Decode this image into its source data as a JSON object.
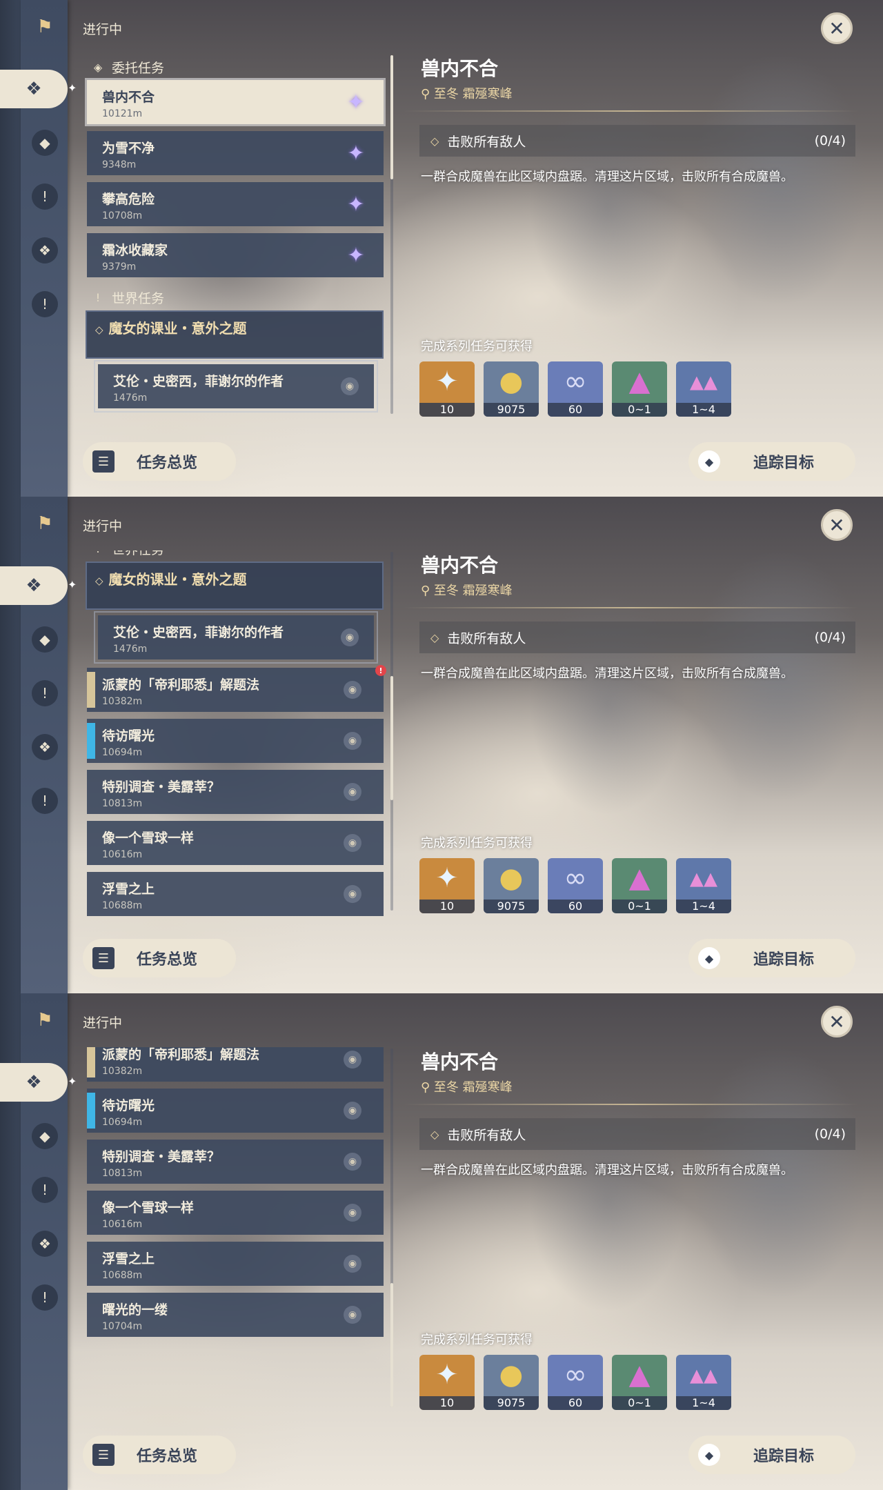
{
  "header": {
    "status_label": "进行中"
  },
  "categories": {
    "commission": "委托任务",
    "world": "世界任务"
  },
  "commission_quests": [
    {
      "name": "兽内不合",
      "distance": "10121m"
    },
    {
      "name": "为雪不净",
      "distance": "9348m"
    },
    {
      "name": "攀高危险",
      "distance": "10708m"
    },
    {
      "name": "霜冰收藏家",
      "distance": "9379m"
    }
  ],
  "world_chapter": {
    "title": "魔女的课业・意外之题"
  },
  "world_sub": {
    "name": "艾伦・史密西，菲谢尔的作者",
    "distance": "1476m"
  },
  "world_quests": [
    {
      "name": "派蒙的「帝利耶悉」解题法",
      "distance": "10382m"
    },
    {
      "name": "待访曙光",
      "distance": "10694m"
    },
    {
      "name": "特别调查・美露莘？",
      "distance": "10813m"
    },
    {
      "name": "像一个雪球一样",
      "distance": "10616m"
    },
    {
      "name": "浮雪之上",
      "distance": "10688m"
    },
    {
      "name": "曙光的一缕",
      "distance": "10704m"
    }
  ],
  "detail": {
    "title": "兽内不合",
    "location": "至冬 霜殛寒峰",
    "objective": "击败所有敌人",
    "progress": "(0/4)",
    "description": "一群合成魔兽在此区域内盘踞。清理这片区域，击败所有合成魔兽。",
    "rewards_label": "完成系列任务可获得",
    "rewards": [
      {
        "icon": "primogem-icon",
        "count": "10",
        "bg": "#c98a3e"
      },
      {
        "icon": "mora-icon",
        "count": "9075",
        "bg": "#6b7f9c"
      },
      {
        "icon": "adventure-exp-icon",
        "count": "60",
        "bg": "#6a7db8"
      },
      {
        "icon": "ore-crystal-icon",
        "count": "0~1",
        "bg": "#5a8a72"
      },
      {
        "icon": "ore-cluster-icon",
        "count": "1~4",
        "bg": "#5f78aa"
      }
    ]
  },
  "buttons": {
    "overview": "任务总览",
    "track": "追踪目标"
  },
  "colors": {
    "accent": "#ece5d5",
    "list_item": "#3e4a60",
    "gold": "#ecd7a6",
    "alert": "#e2454a"
  }
}
